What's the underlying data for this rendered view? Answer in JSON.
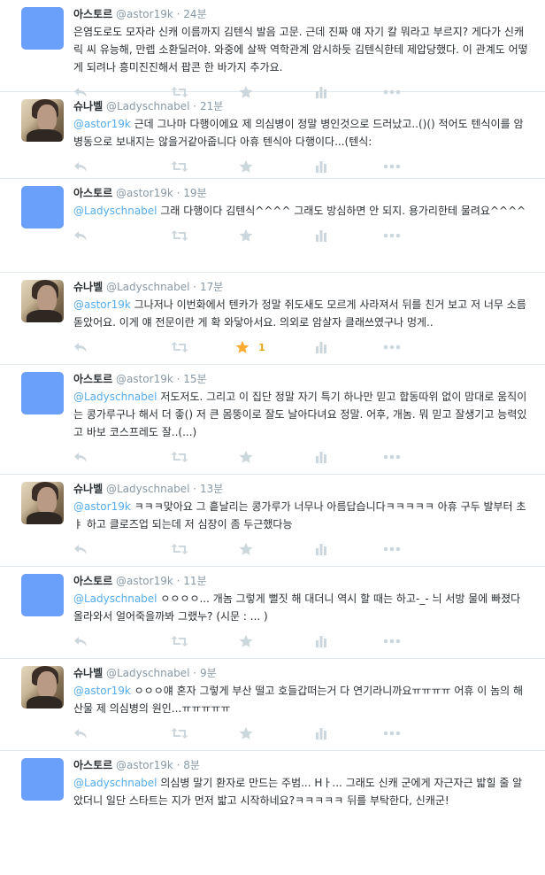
{
  "tweets": [
    {
      "fullname": "아스토르",
      "screenname": "@astor19k",
      "time": "24분",
      "avatar": "blue",
      "mention": "",
      "text": "은염도로도 모자라 신캐 이름까지 김텐식 발음 고문. 근데 진짜 얘 자기 칼 뭐라고 부르지? 게다가 신캐릭 씨 유능해, 만렙 소환딜러야. 와중에 살짝 역학관계 암시하듯 김텐식한테 제압당했다. 이 관계도 어떻게 되려나 흥미진진해서 팝콘 한 바가지 추가요.",
      "favorites": ""
    },
    {
      "fullname": "슈나벨",
      "screenname": "@Ladyschnabel",
      "time": "21분",
      "avatar": "photo",
      "mention": "@astor19k",
      "text": " 근데 그나마 다행이에요 제 의심병이 정말 병인것으로 드러났고..()() 적어도 텐식이를 암병동으로 보내지는 않을거같아줍니다 아휴 텐식아 다행이다...(텐식:",
      "favorites": ""
    },
    {
      "fullname": "아스토르",
      "screenname": "@astor19k",
      "time": "19분",
      "avatar": "blue",
      "mention": "@Ladyschnabel",
      "text": " 그래 다행이다 김텐식^^^^ 그래도 방심하면 안 되지. 용가리한테 물려요^^^^",
      "favorites": ""
    },
    {
      "fullname": "슈나벨",
      "screenname": "@Ladyschnabel",
      "time": "17분",
      "avatar": "photo",
      "mention": "@astor19k",
      "text": " 그나저나 이번화에서 텐카가 정말 쥐도새도 모르게 사라져서 뒤를 친거 보고 저 너무 소름돋았어요. 이게 얘 전문이란 게 확 와닿아서요. 의외로 암살자 클래쓰였구나 멍게..",
      "favorites": "1"
    },
    {
      "fullname": "아스토르",
      "screenname": "@astor19k",
      "time": "15분",
      "avatar": "blue",
      "mention": "@Ladyschnabel",
      "text": " 저도저도. 그리고 이 집단 정말 자기 특기 하나만 믿고 합동따위 없이 맘대로 움직이는 콩가루구나 해서 더 좋() 저 큰 몸뚱이로 잘도 날아다녀요 정말. 어후, 개놈. 뭐 믿고 잘생기고 능력있고 바보 코스프레도 잘..(...)",
      "favorites": ""
    },
    {
      "fullname": "슈나벨",
      "screenname": "@Ladyschnabel",
      "time": "13분",
      "avatar": "photo",
      "mention": "@astor19k",
      "text": " ㅋㅋㅋ맞아요 그 흩날리는 콩가루가 너무나 아름답습니다ㅋㅋㅋㅋㅋ 아휴 구두 발부터 초ㅑ 하고 클로즈업 되는데 저 심장이 좀 두근했다능",
      "favorites": ""
    },
    {
      "fullname": "아스토르",
      "screenname": "@astor19k",
      "time": "11분",
      "avatar": "blue",
      "mention": "@Ladyschnabel",
      "text": " ㅇㅇㅇㅇ... 개놈 그렇게 뻘짓 해 대더니 역시 할 때는 하고-_- 늬 서방 물에 빠졌다 올라와서 얼어죽을까봐 그랬누? (시문 : ... )",
      "favorites": ""
    },
    {
      "fullname": "슈나벨",
      "screenname": "@Ladyschnabel",
      "time": "9분",
      "avatar": "photo",
      "mention": "@astor19k",
      "text": " ㅇㅇㅇ얘 혼자 그렇게 부산 떨고 호들갑떠는거 다 연기라니까요ㅠㅠㅠㅠ 어휴 이 놈의 해산물 제 의심병의 원인...ㅠㅠㅠㅠㅠ",
      "favorites": ""
    },
    {
      "fullname": "아스토르",
      "screenname": "@astor19k",
      "time": "8분",
      "avatar": "blue",
      "mention": "@Ladyschnabel",
      "text": " 의심병 말기 환자로 만드는 주범... Hㅏ... 그래도 신캐 군에게 자근자근 밟힐 줄 알았더니 일단 스타트는 지가 먼저 밟고 시작하네요?ㅋㅋㅋㅋㅋ 뒤를 부탁한다, 신캐군!",
      "favorites": ""
    }
  ],
  "icons": {
    "reply": "reply-icon",
    "retweet": "retweet-icon",
    "favorite": "star-icon",
    "analytics": "analytics-icon",
    "more": "more-icon"
  },
  "colors": {
    "mention": "#55acee",
    "meta": "#8899a6",
    "action_icon": "#ccd6dd",
    "favorite_active": "#ffac33",
    "avatar_default": "#6a9ffa"
  }
}
